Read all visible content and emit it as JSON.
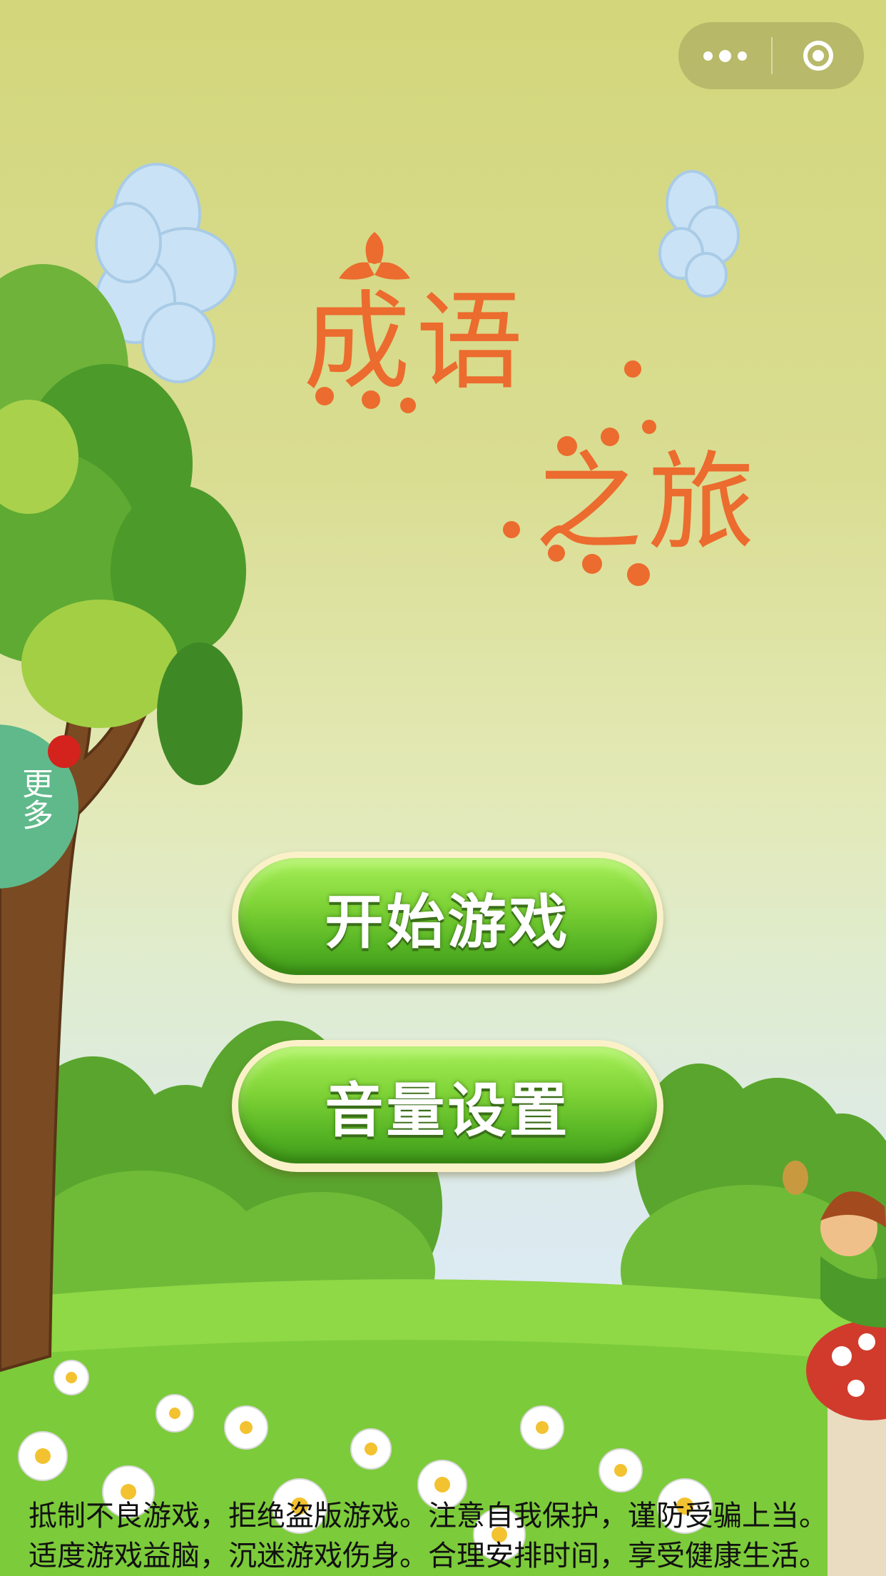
{
  "capsule": {
    "more_icon": "more-dots-icon",
    "close_icon": "target-circle-icon"
  },
  "title": {
    "part1": "成语",
    "part2": "之旅",
    "color": "#ec6b2e"
  },
  "side_tab": {
    "label": "更多",
    "color": "#5fb98a",
    "badge_color": "#d4221c"
  },
  "menu": {
    "start_label": "开始游戏",
    "volume_label": "音量设置",
    "button_color": "#6cc62c"
  },
  "disclaimer": {
    "line1": "抵制不良游戏，拒绝盗版游戏。注意自我保护，谨防受骗上当。",
    "line2": "适度游戏益脑，沉迷游戏伤身。合理安排时间，享受健康生活。"
  }
}
